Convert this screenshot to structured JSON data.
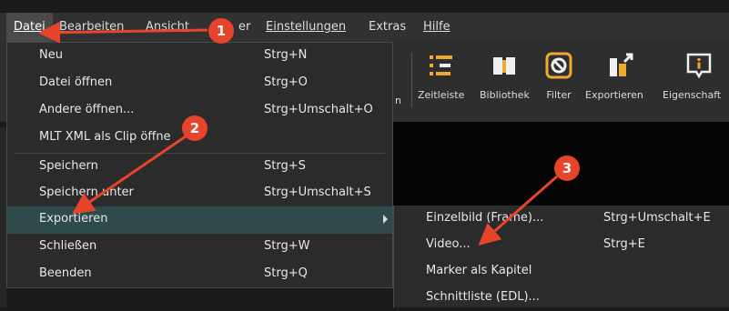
{
  "menubar": {
    "items": [
      {
        "label": "Datei",
        "active": true
      },
      {
        "label": "Bearbeiten"
      },
      {
        "label": "Ansicht"
      },
      {
        "label": "er"
      },
      {
        "label": "Einstellungen"
      },
      {
        "label": "Extras"
      },
      {
        "label": "Hilfe"
      }
    ]
  },
  "toolbar": {
    "items": [
      {
        "label": "Zeitleiste",
        "icon": "timeline-icon"
      },
      {
        "label": "Bibliothek",
        "icon": "library-icon"
      },
      {
        "label": "Filter",
        "icon": "filter-icon"
      },
      {
        "label": "Exportieren",
        "icon": "export-icon"
      },
      {
        "label": "Eigenschaft",
        "icon": "properties-icon"
      }
    ],
    "partial_label": "n"
  },
  "file_menu": {
    "items": [
      {
        "label": "Neu",
        "shortcut": "Strg+N"
      },
      {
        "label": "Datei öffnen",
        "shortcut": "Strg+O"
      },
      {
        "label": "Andere öffnen...",
        "shortcut": "Strg+Umschalt+O"
      },
      {
        "label": "MLT XML als Clip öffne",
        "shortcut": ""
      },
      {
        "label": "Speichern",
        "shortcut": "Strg+S"
      },
      {
        "label": "Speichern unter",
        "shortcut": "Strg+Umschalt+S"
      },
      {
        "label": "Exportieren",
        "shortcut": "",
        "highlighted": true,
        "submenu": true
      },
      {
        "label": "Schließen",
        "shortcut": "Strg+W"
      },
      {
        "label": "Beenden",
        "shortcut": "Strg+Q"
      }
    ]
  },
  "export_submenu": {
    "items": [
      {
        "label": "Einzelbild (Frame)...",
        "shortcut": "Strg+Umschalt+E"
      },
      {
        "label": "Video...",
        "shortcut": "Strg+E"
      },
      {
        "label": "Marker als Kapitel",
        "shortcut": ""
      },
      {
        "label": "Schnittliste (EDL)...",
        "shortcut": ""
      }
    ]
  },
  "annotations": {
    "badges": [
      "1",
      "2",
      "3"
    ],
    "color": "#e8442c"
  },
  "colors": {
    "menu_bg": "#2b2b2b",
    "highlight": "#2f4a4b",
    "menubar_bg": "#313131",
    "toolbar_bg": "#2e2e2e",
    "toolbar_icon_orange": "#f0a830",
    "toolbar_icon_white": "#f0f0f0"
  }
}
